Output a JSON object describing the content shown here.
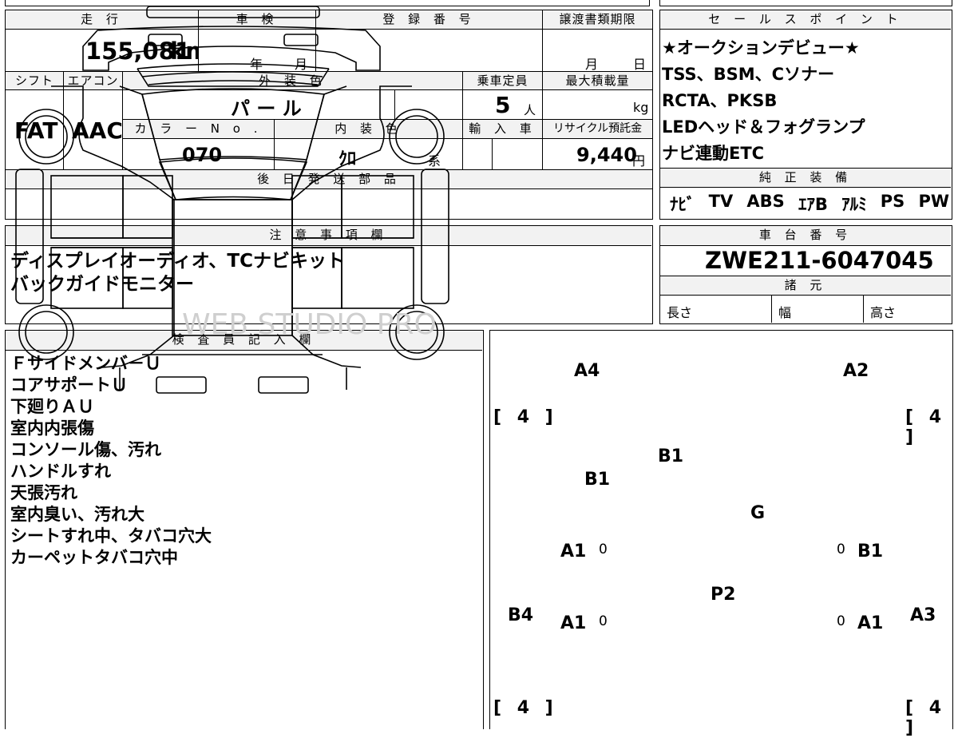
{
  "vehicle": {
    "mileage_label": "走 行",
    "mileage_value": "155,081",
    "mileage_unit": "km",
    "inspection_label": "車 検",
    "year_label": "年",
    "month_label": "月",
    "registration_label": "登 録 番 号",
    "transfer_label": "譲渡書類期限",
    "day_label": "日",
    "shift_label": "シフト",
    "shift_value": "FAT",
    "ac_label": "エアコン",
    "ac_value": "AAC",
    "exterior_label": "外 装 色",
    "exterior_value": "パ ー ル",
    "capacity_label": "乗車定員",
    "capacity_value": "5",
    "capacity_unit": "人",
    "maxload_label": "最大積載量",
    "maxload_unit": "kg",
    "colorno_label": "カ ラ ー N o .",
    "colorno_value": "070",
    "interior_label": "内 装 色",
    "interior_value": "ｸﾛ",
    "interior_unit": "系",
    "import_label": "輸 入 車",
    "recycle_label": "リサイクル預託金",
    "recycle_value": "9,440",
    "recycle_unit": "円",
    "later_parts_label": "後 日 発 送 部 品"
  },
  "sales_points": {
    "title": "セ ー ル ス ポ イ ン ト",
    "items": [
      "★オークションデビュー★",
      "TSS、BSM、Cソナー",
      "RCTA、PKSB",
      "LEDヘッド＆フォグランプ",
      "ナビ連動ETC"
    ]
  },
  "standard_equipment": {
    "title": "純 正 装 備",
    "items": [
      "ﾅﾋﾞ",
      "TV",
      "ABS",
      "ｴｱB",
      "ｱﾙﾐ",
      "PS",
      "PW"
    ]
  },
  "notes": {
    "title": "注 意 事 項 欄",
    "lines": [
      "ディスプレイオーディオ、TCナビキット",
      "バックガイドモニター"
    ]
  },
  "chassis": {
    "title": "車 台 番 号",
    "value": "ZWE211-6047045",
    "specs_title": "諸 元",
    "length_label": "長さ",
    "width_label": "幅",
    "height_label": "高さ"
  },
  "inspector": {
    "title": "検 査 員 記 入 欄",
    "lines": [
      "Ｆサイドメンバ－Ｕ",
      "コアサポートＵ",
      "下廻りＡＵ",
      "室内内張傷",
      "コンソール傷、汚れ",
      "ハンドルすれ",
      "天張汚れ",
      "室内臭い、汚れ大",
      "シートすれ中、タバコ穴大",
      "カーペットタバコ穴中"
    ]
  },
  "diagram": {
    "marks": {
      "front_left": "A4",
      "front_right": "A2",
      "windshield": "B1",
      "left_fender": "B1",
      "hood_rear": "G",
      "left_front_door": "A1",
      "right_front_door": "B1",
      "roof": "P2",
      "left_rear_door": "A1",
      "right_rear_door": "A1",
      "left_quarter": "B4",
      "right_quarter": "A3"
    },
    "tires": [
      "[ 4 ]",
      "[ 4 ]",
      "[ 4 ]",
      "[ 4 ]"
    ],
    "zero": "0",
    "watermark": "WEB STUDIO PRO"
  }
}
